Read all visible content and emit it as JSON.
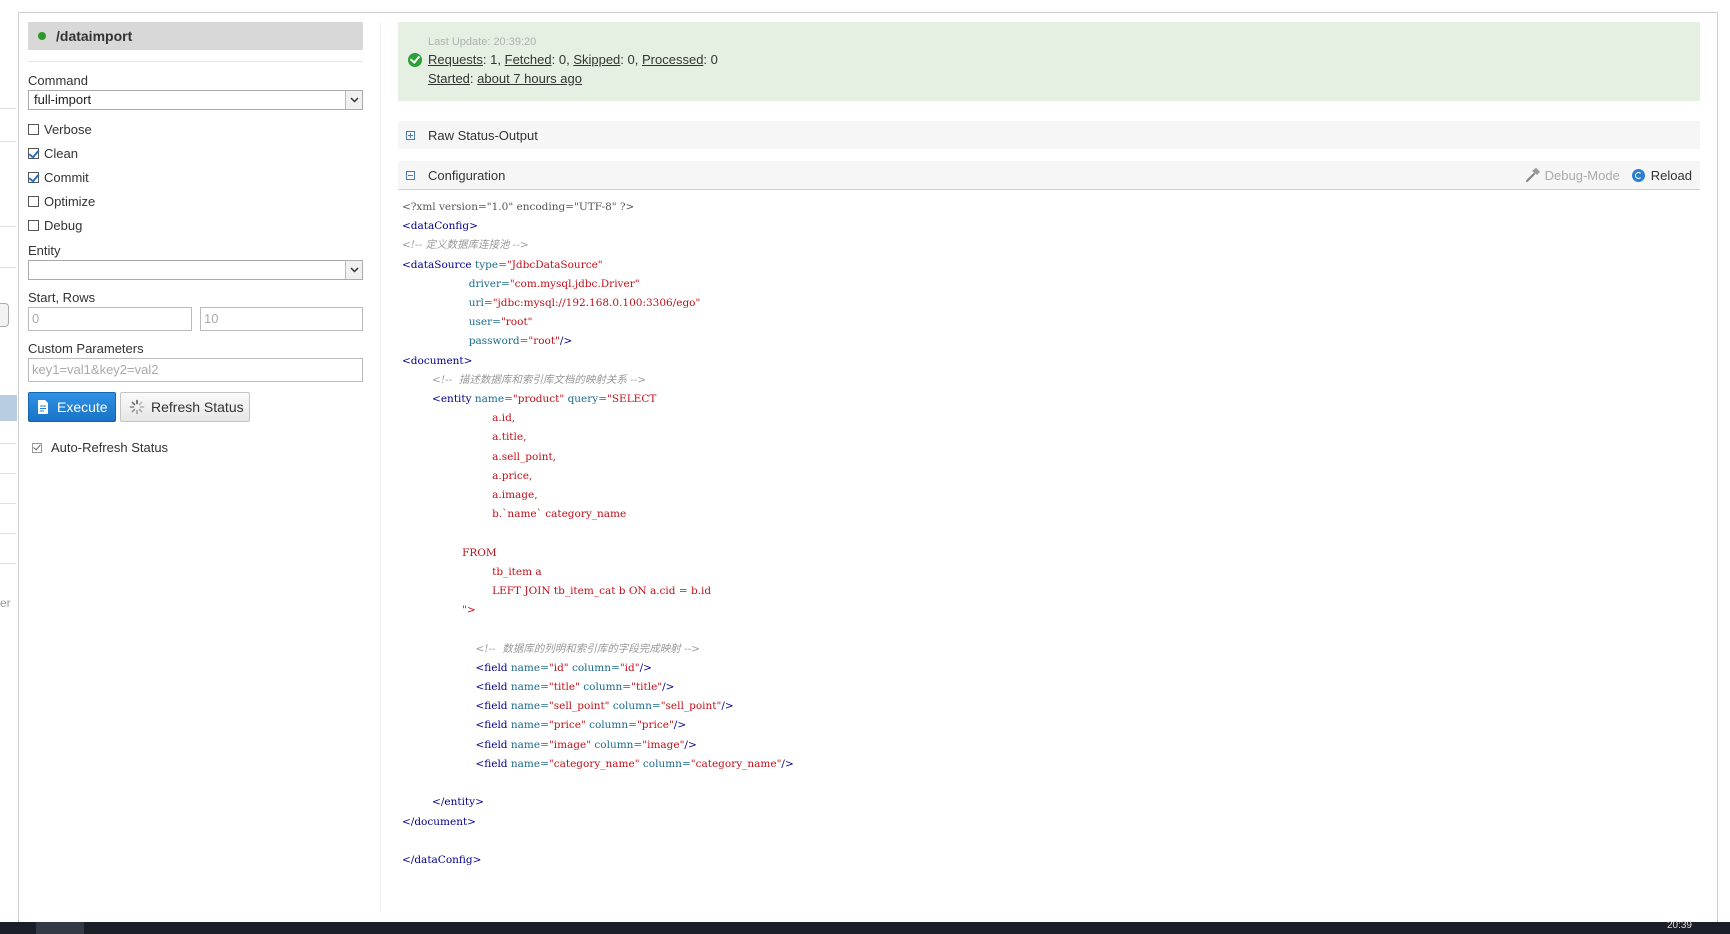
{
  "panel": {
    "title": "/dataimport",
    "command_label": "Command",
    "command_value": "full-import",
    "options": [
      {
        "label": "Verbose",
        "checked": false
      },
      {
        "label": "Clean",
        "checked": true
      },
      {
        "label": "Commit",
        "checked": true
      },
      {
        "label": "Optimize",
        "checked": false
      },
      {
        "label": "Debug",
        "checked": false
      }
    ],
    "entity_label": "Entity",
    "entity_value": "",
    "start_rows_label": "Start, Rows",
    "start_placeholder": "0",
    "rows_placeholder": "10",
    "custom_params_label": "Custom Parameters",
    "custom_params_placeholder": "key1=val1&key2=val2",
    "execute_label": "Execute",
    "refresh_label": "Refresh Status",
    "auto_refresh_label": "Auto-Refresh Status",
    "auto_refresh_checked": true
  },
  "status": {
    "last_update_label": "Last Update:",
    "last_update_time": "20:39:20",
    "requests_label": "Requests",
    "requests": "1",
    "fetched_label": "Fetched",
    "fetched": "0",
    "skipped_label": "Skipped",
    "skipped": "0",
    "processed_label": "Processed",
    "processed": "0",
    "started_label": "Started",
    "started_value": "about 7 hours ago"
  },
  "raw_status_label": "Raw Status-Output",
  "configuration_label": "Configuration",
  "debug_mode_label": "Debug-Mode",
  "reload_label": "Reload",
  "sidebar_fragment": "er",
  "taskbar_clock": "20:39",
  "code": {
    "l1": "<?xml version=\"1.0\" encoding=\"UTF-8\" ?>",
    "l2": "<dataConfig>",
    "l3": "<!-- 定义数据库连接池 -->",
    "l4_tag": "<dataSource",
    "l4_attr": "type=",
    "l4_val": "\"JdbcDataSource\"",
    "l5_attr": "driver=",
    "l5_val": "\"com.mysql.jdbc.Driver\"",
    "l6_attr": "url=",
    "l6_val": "\"jdbc:mysql://192.168.0.100:3306/ego\"",
    "l7_attr": "user=",
    "l7_val": "\"root\"",
    "l8_attr": "password=",
    "l8_val": "\"root\"",
    "l8_end": "/>",
    "l9": "<document>",
    "l10": "<!--  描述数据库和索引库文档的映射关系 -->",
    "l11_tag": "<entity",
    "l11_a1": "name=",
    "l11_v1": "\"product\"",
    "l11_a2": "query=",
    "l11_v2": "\"SELECT",
    "sql": [
      "a.id,",
      "a.title,",
      "a.sell_point,",
      "a.price,",
      "a.image,",
      "b.`name` category_name"
    ],
    "from": "FROM",
    "from1": "tb_item a",
    "from2": "LEFT JOIN tb_item_cat b ON a.cid = b.id",
    "close_query": "\">",
    "fields_comment": "<!--  数据库的列明和索引库的字段完成映射 -->",
    "fields": [
      {
        "name": "\"id\"",
        "column": "\"id\""
      },
      {
        "name": "\"title\"",
        "column": "\"title\""
      },
      {
        "name": "\"sell_point\"",
        "column": "\"sell_point\""
      },
      {
        "name": "\"price\"",
        "column": "\"price\""
      },
      {
        "name": "\"image\"",
        "column": "\"image\""
      },
      {
        "name": "\"category_name\"",
        "column": "\"category_name\""
      }
    ],
    "field_tag": "<field",
    "field_name_attr": "name=",
    "field_column_attr": "column=",
    "field_end": "/>",
    "entity_close": "</entity>",
    "document_close": "</document>",
    "dataconfig_close": "</dataConfig>"
  }
}
